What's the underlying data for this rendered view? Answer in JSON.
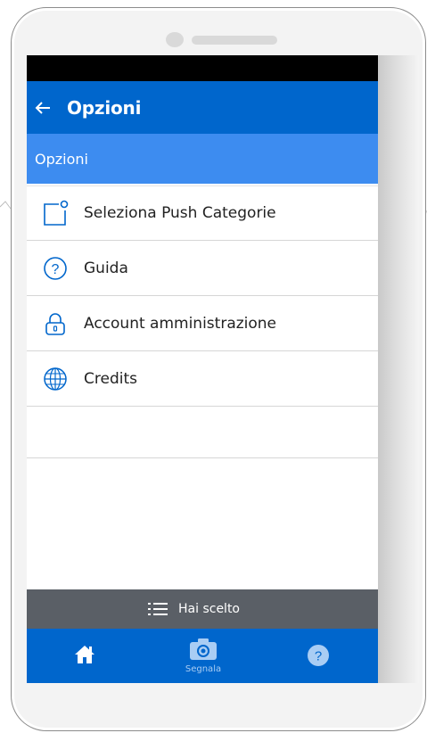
{
  "app_bar": {
    "title": "Opzioni"
  },
  "section": {
    "title": "Opzioni"
  },
  "menu": {
    "items": [
      {
        "label": "Seleziona Push Categorie",
        "icon": "push-category-icon"
      },
      {
        "label": "Guida",
        "icon": "question-circle-icon"
      },
      {
        "label": "Account amministrazione",
        "icon": "lock-icon"
      },
      {
        "label": "Credits",
        "icon": "globe-icon"
      }
    ]
  },
  "selection_bar": {
    "label": "Hai scelto",
    "icon": "list-icon"
  },
  "bottom_nav": {
    "home_icon": "home-icon",
    "report_label": "Segnala",
    "report_icon": "camera-icon",
    "help_icon": "help-icon"
  },
  "colors": {
    "primary": "#0066cc",
    "section_header": "#3d8cf0",
    "selection_bar": "#5a5f66",
    "status_bar": "#000000"
  }
}
